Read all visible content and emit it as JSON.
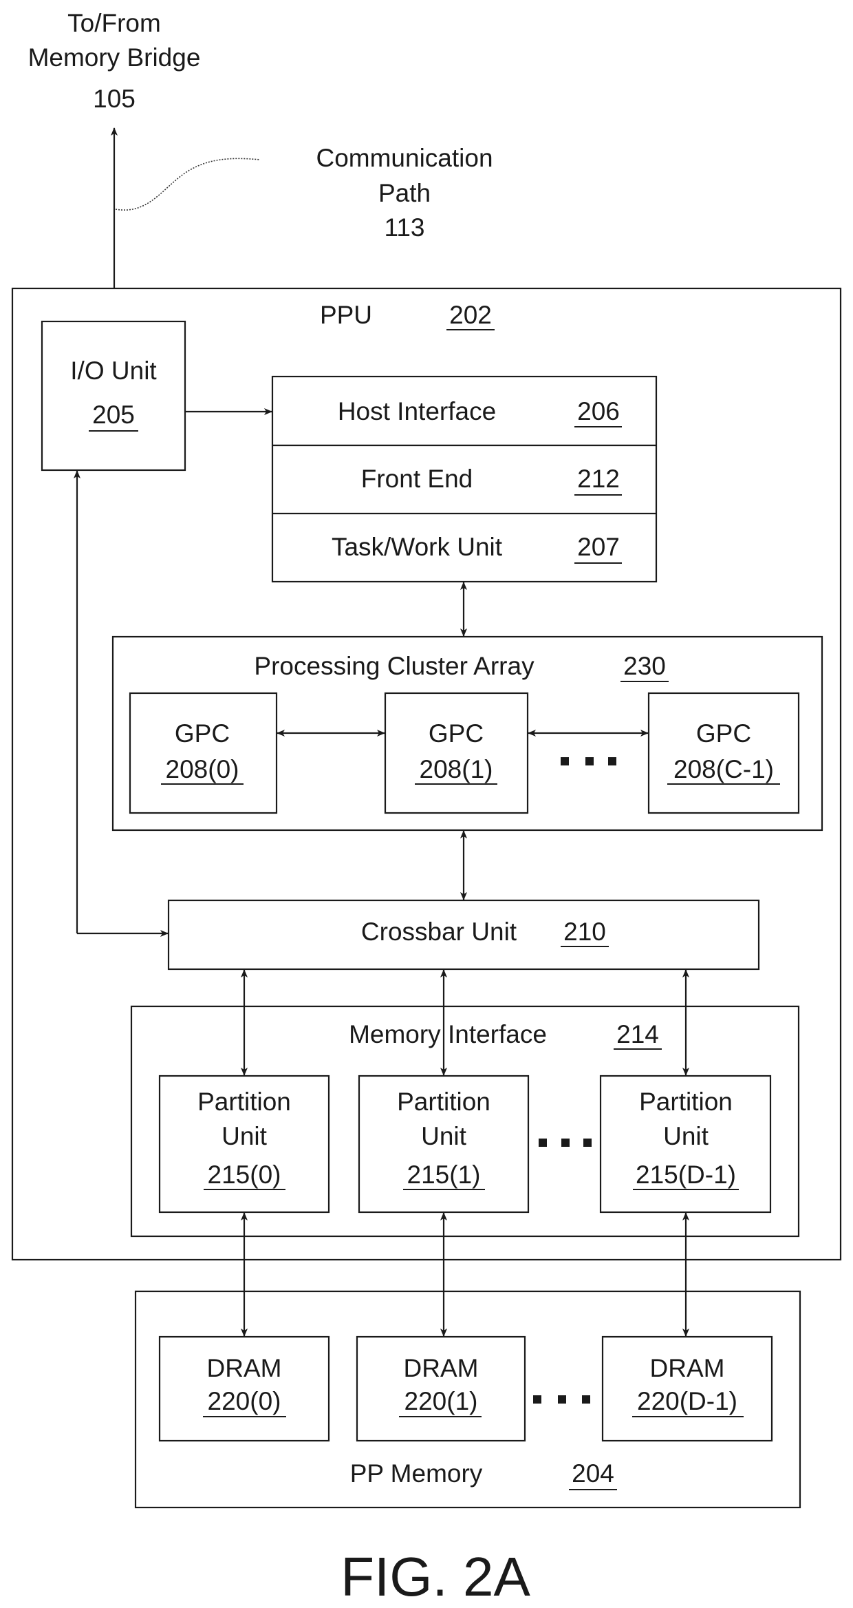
{
  "figure": {
    "caption": "FIG. 2A",
    "external": {
      "memory_bridge": {
        "line1": "To/From",
        "line2": "Memory Bridge",
        "ref": "105"
      },
      "communication_path": {
        "line1": "Communication",
        "line2": "Path",
        "ref": "113"
      }
    },
    "ppu": {
      "label": "PPU",
      "ref": "202",
      "io_unit": {
        "label": "I/O Unit",
        "ref": "205"
      },
      "host_stack": [
        {
          "label": "Host Interface",
          "ref": "206"
        },
        {
          "label": "Front End",
          "ref": "212"
        },
        {
          "label": "Task/Work Unit",
          "ref": "207"
        }
      ],
      "processing_cluster_array": {
        "label": "Processing Cluster Array",
        "ref": "230",
        "gpcs": [
          {
            "label": "GPC",
            "ref": "208(0)"
          },
          {
            "label": "GPC",
            "ref": "208(1)"
          },
          {
            "label": "GPC",
            "ref": "208(C-1)"
          }
        ]
      },
      "crossbar": {
        "label": "Crossbar Unit",
        "ref": "210"
      },
      "memory_interface": {
        "label": "Memory Interface",
        "ref": "214",
        "partitions": [
          {
            "line1": "Partition",
            "line2": "Unit",
            "ref": "215(0)"
          },
          {
            "line1": "Partition",
            "line2": "Unit",
            "ref": "215(1)"
          },
          {
            "line1": "Partition",
            "line2": "Unit",
            "ref": "215(D-1)"
          }
        ]
      }
    },
    "pp_memory": {
      "label": "PP Memory",
      "ref": "204",
      "drams": [
        {
          "label": "DRAM",
          "ref": "220(0)"
        },
        {
          "label": "DRAM",
          "ref": "220(1)"
        },
        {
          "label": "DRAM",
          "ref": "220(D-1)"
        }
      ]
    }
  }
}
